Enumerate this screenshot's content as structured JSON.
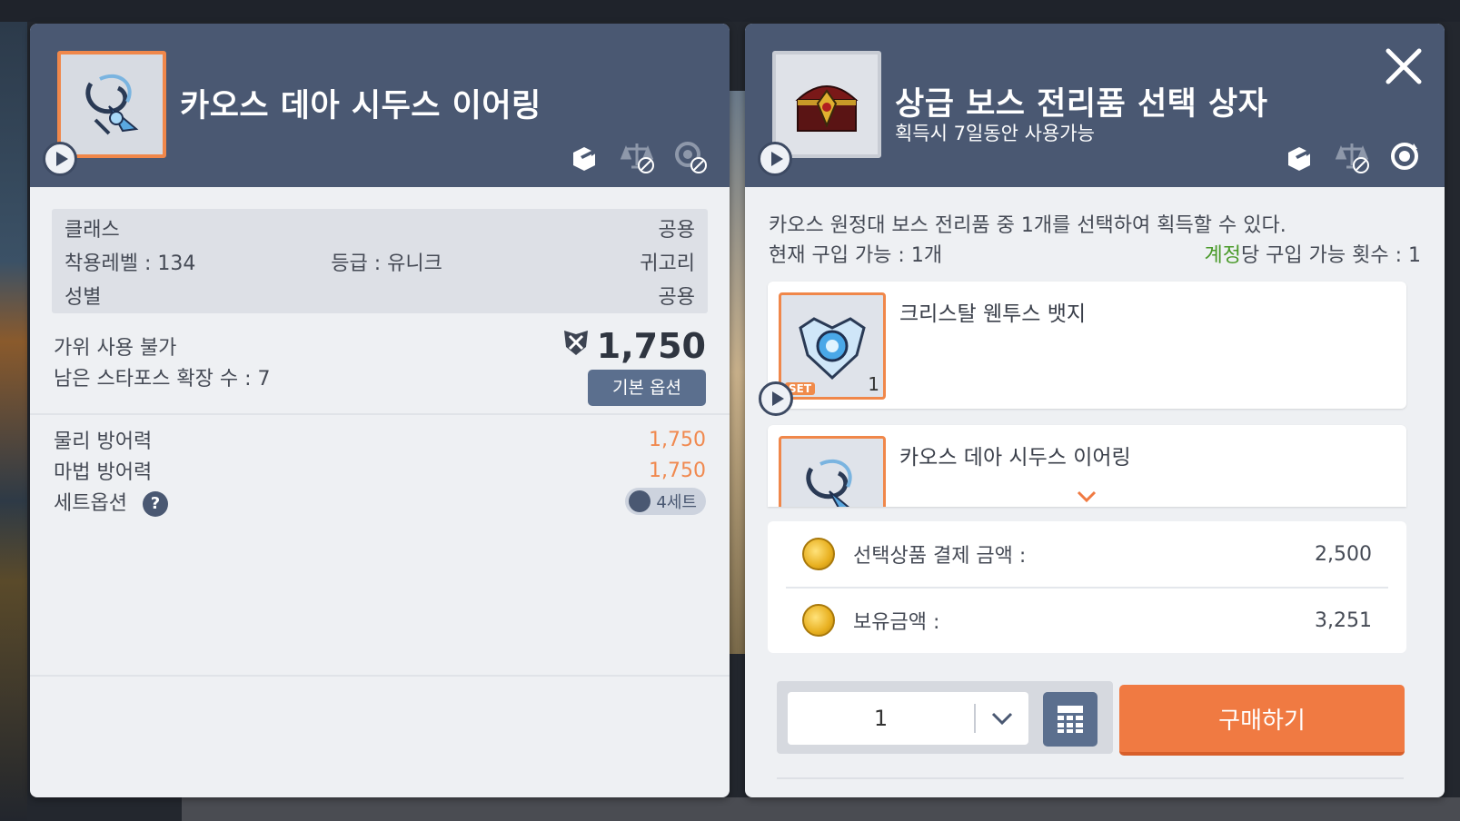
{
  "left_panel": {
    "item_name": "카오스 데아 시두스 이어링",
    "info": {
      "class_label": "클래스",
      "class_value": "공용",
      "level_label": "착용레벨 : 134",
      "grade_label": "등급 : 유니크",
      "category_value": "귀고리",
      "gender_label": "성별",
      "gender_value": "공용"
    },
    "scissors_text": "가위 사용 불가",
    "starforce_text": "남은 스타포스 확장 수 : 7",
    "combat_power": "1,750",
    "basic_option_button": "기본 옵션",
    "stats": [
      {
        "label": "물리 방어력",
        "value": "1,750"
      },
      {
        "label": "마법 방어력",
        "value": "1,750"
      }
    ],
    "set_option_label": "세트옵션",
    "set_badge": "4세트"
  },
  "right_panel": {
    "item_name": "상급 보스 전리품 선택 상자",
    "item_subtitle": "획득시 7일동안 사용가능",
    "description": "카오스 원정대 보스 전리품 중 1개를 선택하여 획득할 수 있다.",
    "purchase_available": "현재 구입 가능 : 1개",
    "account_limit_highlight": "계정",
    "account_limit_rest": "당 구입 가능 횟수 : 1",
    "choices": [
      {
        "name": "크리스탈 웬투스 뱃지",
        "set_tag": "SET",
        "qty": "1"
      },
      {
        "name": "카오스 데아 시두스 이어링"
      }
    ],
    "payment": {
      "selected_label": "선택상품 결제 금액 :",
      "selected_value": "2,500",
      "owned_label": "보유금액 :",
      "owned_value": "3,251"
    },
    "quantity": "1",
    "buy_button": "구매하기"
  },
  "colors": {
    "header_bg": "#4a5872",
    "accent_orange": "#f07a42",
    "stat_orange": "#f0894f",
    "green": "#4a9a2a"
  },
  "icons": [
    "play-icon",
    "share-icon",
    "trade-blocked-icon",
    "restore-blocked-icon",
    "close-icon",
    "coin-icon",
    "chevron-down-icon",
    "calculator-icon",
    "help-icon",
    "set-icon",
    "combat-power-icon"
  ]
}
